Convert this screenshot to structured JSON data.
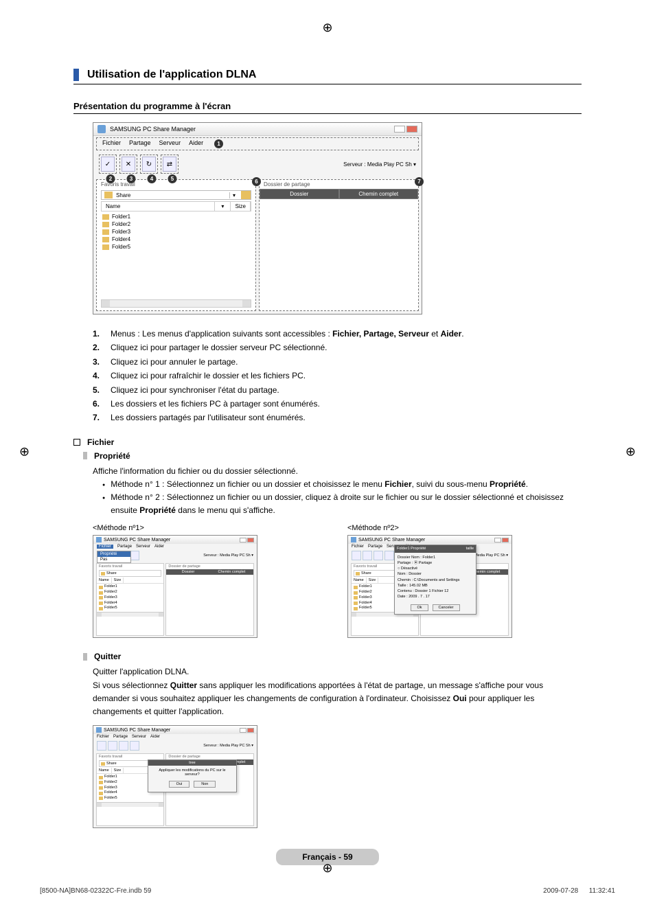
{
  "title": "Utilisation de l'application DLNA",
  "section": "Présentation du programme à l'écran",
  "app": {
    "window_title": "SAMSUNG PC Share Manager",
    "menus": {
      "m1": "Fichier",
      "m2": "Partage",
      "m3": "Serveur",
      "m4": "Aider"
    },
    "server_label": "Serveur :",
    "server_value": "Media Play PC Sh ▾",
    "left_panel_title": "Favoris travail",
    "share_folder": "Share",
    "columns": {
      "name": "Name",
      "size": "Size"
    },
    "folders": [
      "Folder1",
      "Folder2",
      "Folder3",
      "Folder4",
      "Folder5"
    ],
    "right_panel_title": "Dossier de partage",
    "right_cols": {
      "dossier": "Dossier",
      "chemin": "Chemin complet"
    }
  },
  "steps": [
    {
      "num": "1.",
      "text_a": "Menus : Les menus d'application suivants sont accessibles : ",
      "bold": "Fichier, Partage, Serveur",
      "text_b": " et ",
      "bold2": "Aider",
      "text_c": "."
    },
    {
      "num": "2.",
      "text": "Cliquez ici pour partager le dossier serveur PC sélectionné."
    },
    {
      "num": "3.",
      "text": "Cliquez ici pour annuler le partage."
    },
    {
      "num": "4.",
      "text": "Cliquez ici pour rafraîchir le dossier et les fichiers PC."
    },
    {
      "num": "5.",
      "text": "Cliquez ici pour synchroniser l'état du partage."
    },
    {
      "num": "6.",
      "text": "Les dossiers et les fichiers PC à partager sont énumérés."
    },
    {
      "num": "7.",
      "text": "Les dossiers partagés par l'utilisateur sont énumérés."
    }
  ],
  "fichier_heading": "Fichier",
  "propriete": {
    "heading": "Propriété",
    "intro": "Affiche l'information du fichier ou du dossier sélectionné.",
    "m1_a": "Méthode n° 1 : Sélectionnez un fichier ou un dossier et choisissez le menu ",
    "m1_b1": "Fichier",
    "m1_c": ", suivi du sous-menu ",
    "m1_b2": "Propriété",
    "m1_d": ".",
    "m2_a": "Méthode n° 2 : Sélectionnez un fichier ou un dossier, cliquez à droite sur le fichier ou sur le dossier sélectionné et choisissez ensuite ",
    "m2_b": "Propriété",
    "m2_c": " dans le menu qui s'affiche."
  },
  "method_labels": {
    "m1": "<Méthode nº1>",
    "m2": "<Méthode nº2>"
  },
  "mini": {
    "menu_open": "Fichier",
    "menu_items": [
      "Propriété",
      "Pas"
    ],
    "toolbar_server": "Serveur : Media Play PC Sh ▾",
    "left_panel_title": "Favoris travail",
    "share": "Share",
    "col_name": "Name",
    "col_size": "Size",
    "right_panel_title": "Dossier de partage",
    "r_dossier": "Dossier",
    "r_chemin": "Chemin complet"
  },
  "prop_dialog": {
    "title": "Folder1 Propriété",
    "l1": "Dossier Nom : Folder1",
    "l2": "Partage :   ⦿ Partage",
    "l3": "            ○ Désactivé",
    "l4": "Nom : Dossier",
    "l5": "Chemin : C:\\Documents and Settings",
    "l6": "Taille : 145.02 MB",
    "l7": "Contenu : Dossier 1 Fichier 12",
    "l8": "Date : 2009 . 7 . 17",
    "btn_ok": "Ok",
    "btn_cancel": "Canceler",
    "side_label": "taille"
  },
  "quitter": {
    "heading": "Quitter",
    "l1": "Quitter l'application DLNA.",
    "l2_a": "Si vous sélectionnez ",
    "l2_b1": "Quitter",
    "l2_c": " sans appliquer les modifications apportées à l'état de partage, un message s'affiche pour vous demander si vous souhaitez appliquer les changements de configuration à l'ordinateur. Choisissez ",
    "l2_b2": "Oui",
    "l2_d": " pour appliquer les changements et quitter l'application."
  },
  "quit_dialog": {
    "bar": "tree",
    "msg": "Appliquer les modifications du PC sur le serveur?",
    "ok": "Oui",
    "no": "Non"
  },
  "page_number": "Français - 59",
  "footer_left": "[8500-NA]BN68-02322C-Fre.indb   59",
  "footer_right": "2009-07-28      11:32:41"
}
